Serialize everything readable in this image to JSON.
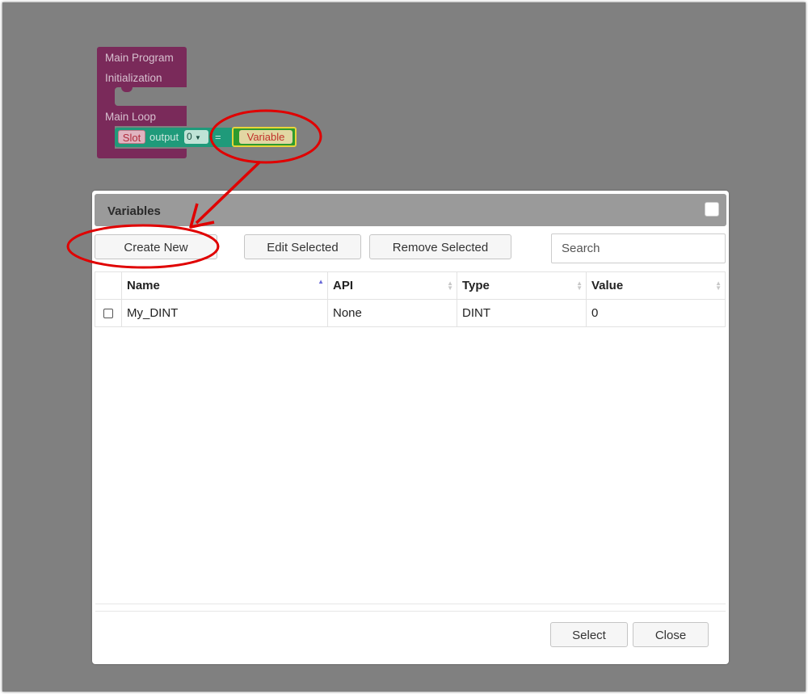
{
  "blocks": {
    "main_program": "Main Program",
    "initialization": "Initialization",
    "main_loop": "Main Loop",
    "slot": "Slot",
    "output": "output",
    "output_index": "0",
    "equals": "=",
    "variable": "Variable"
  },
  "dialog": {
    "title": "Variables",
    "toolbar": {
      "create_new": "Create New",
      "edit_selected": "Edit Selected",
      "remove_selected": "Remove Selected",
      "search_placeholder": "Search"
    },
    "table": {
      "columns": [
        "Name",
        "API",
        "Type",
        "Value"
      ],
      "rows": [
        {
          "name": "My_DINT",
          "api": "None",
          "type": "DINT",
          "value": "0",
          "checked": false
        }
      ],
      "sort_column": "Name"
    },
    "footer": {
      "select": "Select",
      "close": "Close"
    }
  },
  "colors": {
    "background": "#808080",
    "block_main": "#7a2a5a",
    "block_statement": "#1f9a7a",
    "annotation": "#e00000"
  }
}
